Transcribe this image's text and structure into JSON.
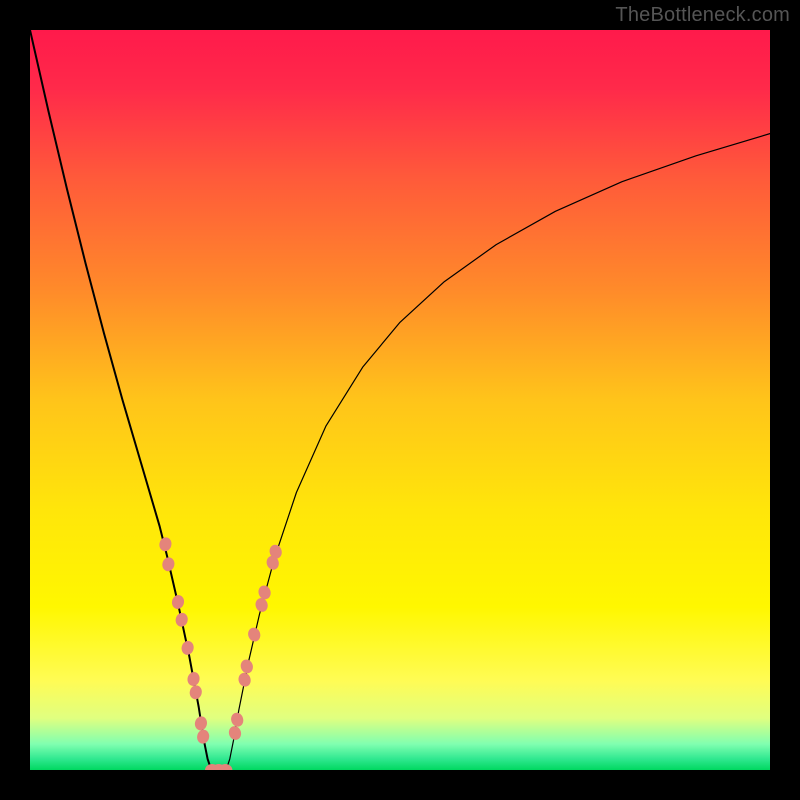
{
  "watermark": "TheBottleneck.com",
  "chart_data": {
    "type": "line",
    "title": "",
    "xlabel": "",
    "ylabel": "",
    "xlim": [
      0,
      100
    ],
    "ylim": [
      0,
      100
    ],
    "grid": false,
    "background_gradient": {
      "stops": [
        {
          "offset": 0.0,
          "color": "#ff1a4b"
        },
        {
          "offset": 0.08,
          "color": "#ff2a4a"
        },
        {
          "offset": 0.2,
          "color": "#ff5a3a"
        },
        {
          "offset": 0.35,
          "color": "#ff8a2a"
        },
        {
          "offset": 0.5,
          "color": "#ffc41a"
        },
        {
          "offset": 0.65,
          "color": "#ffe60a"
        },
        {
          "offset": 0.78,
          "color": "#fff700"
        },
        {
          "offset": 0.88,
          "color": "#fffc55"
        },
        {
          "offset": 0.93,
          "color": "#e0ff80"
        },
        {
          "offset": 0.965,
          "color": "#80ffb0"
        },
        {
          "offset": 0.985,
          "color": "#30e890"
        },
        {
          "offset": 1.0,
          "color": "#00d860"
        }
      ]
    },
    "series": [
      {
        "name": "left-curve",
        "x": [
          0.0,
          2.5,
          5.0,
          7.5,
          10.0,
          12.5,
          15.0,
          17.5,
          18.5,
          20.0,
          21.5,
          22.8,
          23.5,
          24.0,
          24.5
        ],
        "y": [
          100.0,
          89.0,
          78.5,
          68.5,
          59.0,
          50.0,
          41.5,
          33.0,
          29.0,
          22.5,
          15.5,
          8.5,
          4.0,
          1.5,
          0.0
        ]
      },
      {
        "name": "right-curve",
        "x": [
          26.5,
          27.0,
          27.5,
          28.2,
          29.5,
          31.0,
          33.0,
          36.0,
          40.0,
          45.0,
          50.0,
          56.0,
          63.0,
          71.0,
          80.0,
          90.0,
          100.0
        ],
        "y": [
          0.0,
          1.5,
          4.0,
          8.0,
          14.5,
          21.0,
          28.5,
          37.5,
          46.5,
          54.5,
          60.5,
          66.0,
          71.0,
          75.5,
          79.5,
          83.0,
          86.0
        ]
      },
      {
        "name": "floor",
        "x": [
          24.5,
          26.5
        ],
        "y": [
          0.0,
          0.0
        ]
      }
    ],
    "markers": {
      "left": [
        {
          "x": 18.3,
          "y": 30.5
        },
        {
          "x": 18.7,
          "y": 27.8
        },
        {
          "x": 20.0,
          "y": 22.7
        },
        {
          "x": 20.5,
          "y": 20.3
        },
        {
          "x": 21.3,
          "y": 16.5
        },
        {
          "x": 22.1,
          "y": 12.3
        },
        {
          "x": 22.4,
          "y": 10.5
        },
        {
          "x": 23.1,
          "y": 6.3
        },
        {
          "x": 23.4,
          "y": 4.5
        }
      ],
      "bottom": [
        {
          "x": 24.6,
          "y": 0.0
        },
        {
          "x": 25.5,
          "y": 0.0
        },
        {
          "x": 26.4,
          "y": 0.0
        }
      ],
      "right": [
        {
          "x": 27.7,
          "y": 5.0
        },
        {
          "x": 28.0,
          "y": 6.8
        },
        {
          "x": 29.0,
          "y": 12.2
        },
        {
          "x": 29.3,
          "y": 14.0
        },
        {
          "x": 30.3,
          "y": 18.3
        },
        {
          "x": 31.3,
          "y": 22.3
        },
        {
          "x": 31.7,
          "y": 24.0
        },
        {
          "x": 32.8,
          "y": 28.0
        },
        {
          "x": 33.2,
          "y": 29.5
        }
      ]
    },
    "marker_style": {
      "fill": "#e4847b",
      "rx": 6,
      "ry": 7
    },
    "line_style": {
      "stroke": "#000000",
      "width_main": 2.0,
      "width_thin": 1.2
    }
  }
}
